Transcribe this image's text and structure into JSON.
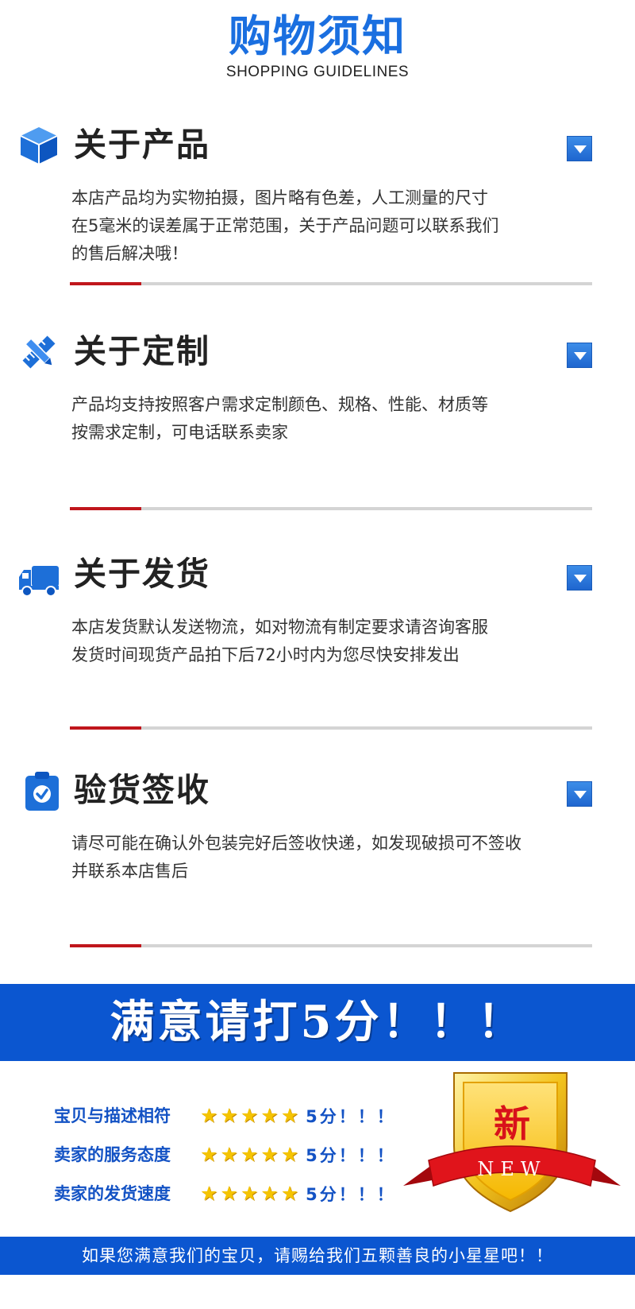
{
  "header": {
    "title": "购物须知",
    "subtitle": "SHOPPING GUIDELINES"
  },
  "sections": [
    {
      "icon": "cube-icon",
      "title": "关于产品",
      "lines": [
        "本店产品均为实物拍摄，图片略有色差，人工测量的尺寸",
        "在5毫米的误差属于正常范围，关于产品问题可以联系我们",
        "的售后解决哦！"
      ]
    },
    {
      "icon": "ruler-pencil-icon",
      "title": "关于定制",
      "lines": [
        "产品均支持按照客户需求定制颜色、规格、性能、材质等",
        "按需求定制，可电话联系卖家"
      ]
    },
    {
      "icon": "truck-icon",
      "title": "关于发货",
      "lines": [
        "本店发货默认发送物流，如对物流有制定要求请咨询客服",
        "发货时间现货产品拍下后72小时内为您尽快安排发出"
      ]
    },
    {
      "icon": "clipboard-check-icon",
      "title": "验货签收",
      "lines": [
        "请尽可能在确认外包装完好后签收快递，如发现破损可不签收",
        "并联系本店售后"
      ]
    }
  ],
  "banner": {
    "text": "满意请打5分！！！"
  },
  "ratings": [
    {
      "label": "宝贝与描述相符",
      "stars": 5,
      "score": "5分！！！"
    },
    {
      "label": "卖家的服务态度",
      "stars": 5,
      "score": "5分！！！"
    },
    {
      "label": "卖家的发货速度",
      "stars": 5,
      "score": "5分！！！"
    }
  ],
  "badge": {
    "char": "新",
    "text": "NEW"
  },
  "footer": {
    "text": "如果您满意我们的宝贝，请赐给我们五颗善良的小星星吧！！"
  },
  "colors": {
    "brand_blue": "#0b56d0",
    "accent_red": "#c0161c",
    "star_gold": "#f5c400"
  }
}
